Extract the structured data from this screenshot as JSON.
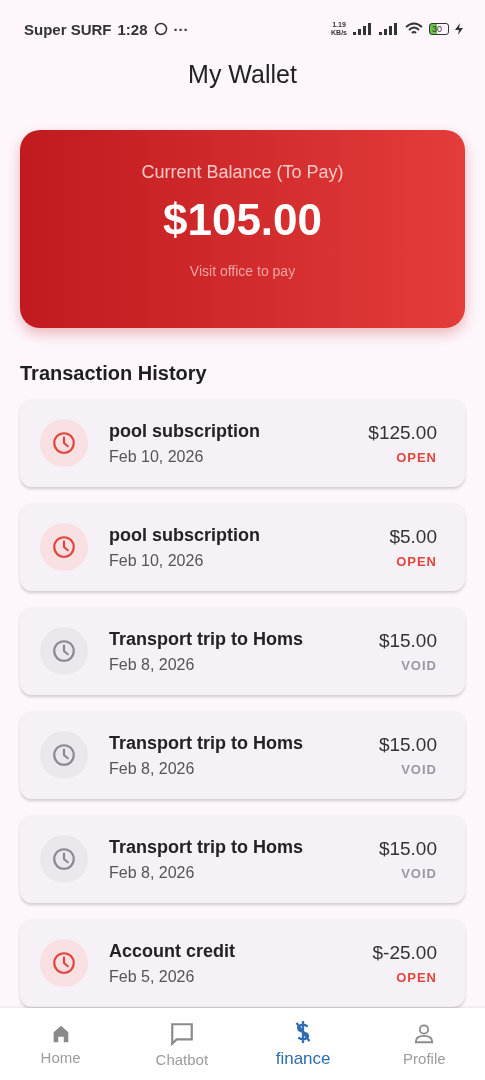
{
  "status_bar": {
    "carrier": "Super SURF",
    "time": "1:28",
    "more": "···",
    "speed": "1.19",
    "speed_unit": "KB/s",
    "battery": "30"
  },
  "title": "My Wallet",
  "balance": {
    "label": "Current Balance (To Pay)",
    "amount": "$105.00",
    "note": "Visit office to pay"
  },
  "history_title": "Transaction History",
  "transactions": [
    {
      "title": "pool subscription",
      "date": "Feb 10, 2026",
      "amount": "$125.00",
      "status": "OPEN",
      "kind": "open"
    },
    {
      "title": "pool subscription",
      "date": "Feb 10, 2026",
      "amount": "$5.00",
      "status": "OPEN",
      "kind": "open"
    },
    {
      "title": "Transport trip to Homs",
      "date": "Feb 8, 2026",
      "amount": "$15.00",
      "status": "VOID",
      "kind": "void"
    },
    {
      "title": "Transport trip to Homs",
      "date": "Feb 8, 2026",
      "amount": "$15.00",
      "status": "VOID",
      "kind": "void"
    },
    {
      "title": "Transport trip to Homs",
      "date": "Feb 8, 2026",
      "amount": "$15.00",
      "status": "VOID",
      "kind": "void"
    },
    {
      "title": "Account credit",
      "date": "Feb 5, 2026",
      "amount": "$-25.00",
      "status": "OPEN",
      "kind": "open"
    }
  ],
  "nav": [
    {
      "label": "Home",
      "kind": "home",
      "selected": false
    },
    {
      "label": "Chatbot",
      "kind": "chat",
      "selected": false
    },
    {
      "label": "finance",
      "kind": "finance",
      "selected": true
    },
    {
      "label": "Profile",
      "kind": "profile",
      "selected": false
    }
  ]
}
